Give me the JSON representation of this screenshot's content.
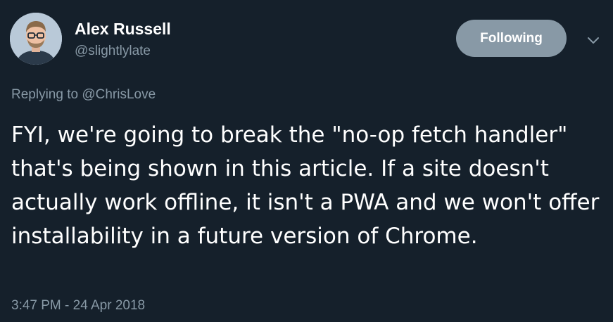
{
  "author": {
    "display_name": "Alex Russell",
    "handle": "@slightlylate"
  },
  "follow_button": {
    "label": "Following"
  },
  "menu": {
    "icon": "chevron-down-icon"
  },
  "reply": {
    "prefix": "Replying to ",
    "mention": "@ChrisLove"
  },
  "tweet": {
    "text": "FYI, we're going to break the \"no-op fetch handler\" that's being shown in this article. If a site doesn't actually work offline, it isn't a PWA and we won't offer installability in a future version of Chrome.",
    "timestamp": "3:47 PM - 24 Apr 2018"
  },
  "colors": {
    "background": "#15202b",
    "primary_text": "#ffffff",
    "secondary_text": "#8899a6",
    "button_bg": "#8899a6"
  }
}
